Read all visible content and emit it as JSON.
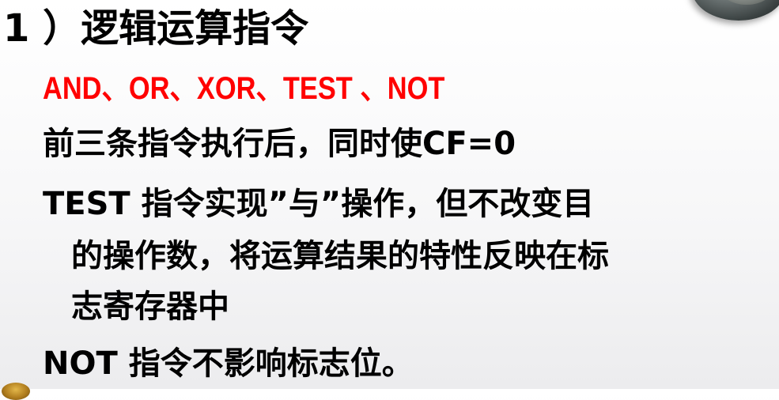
{
  "heading": "1 ）逻辑运算指令",
  "instructions": "AND、OR、XOR、TEST 、NOT",
  "line1": "前三条指令执行后，同时使CF=0",
  "line2": "TEST 指令实现”与”操作，但不改变目",
  "line2b": "的操作数，将运算结果的特性反映在标",
  "line2c": "志寄存器中",
  "line3": "NOT 指令不影响标志位。",
  "colors": {
    "accent": "#ff0000",
    "text": "#000000"
  }
}
